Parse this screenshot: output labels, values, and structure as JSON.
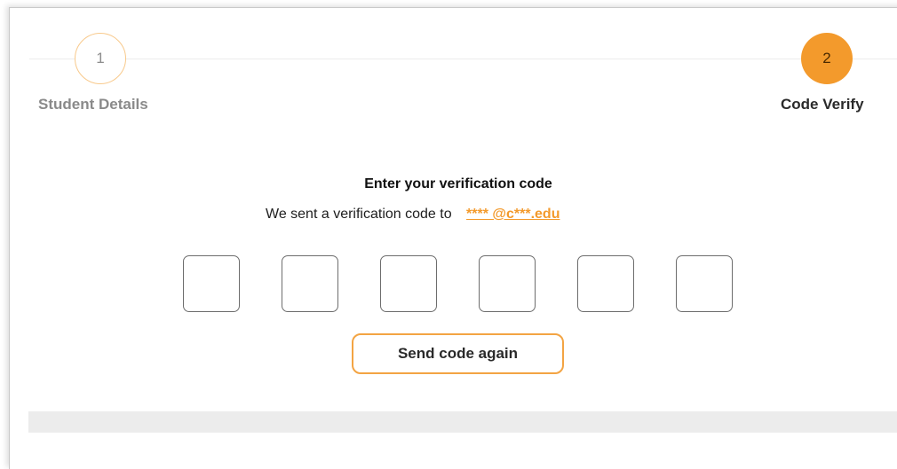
{
  "stepper": {
    "steps": [
      {
        "number": "1",
        "label": "Student Details",
        "state": "completed"
      },
      {
        "number": "2",
        "label": "Code Verify",
        "state": "active"
      }
    ]
  },
  "verification": {
    "title": "Enter your verification code",
    "sent_text": "We sent a verification code to",
    "masked_email": "**** @c***.edu",
    "code_digits": [
      "",
      "",
      "",
      "",
      "",
      ""
    ]
  },
  "actions": {
    "resend_label": "Send code again"
  },
  "colors": {
    "accent": "#f39a2c",
    "accent_light": "#f8c98b",
    "text_dark": "#2a2a2a",
    "text_muted": "#8a8a8a",
    "box_border": "#6d6d6d"
  }
}
